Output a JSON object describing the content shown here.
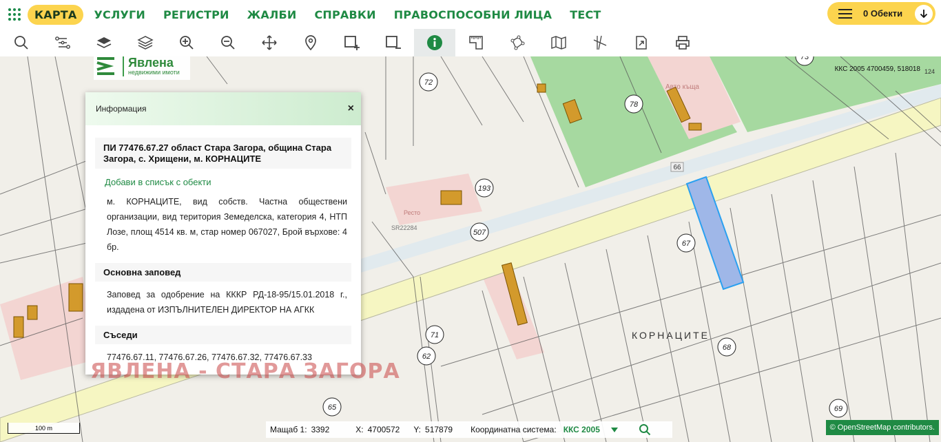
{
  "nav": {
    "items": [
      {
        "label": "КАРТА",
        "active": true
      },
      {
        "label": "УСЛУГИ"
      },
      {
        "label": "РЕГИСТРИ"
      },
      {
        "label": "ЖАЛБИ"
      },
      {
        "label": "СПРАВКИ"
      },
      {
        "label": "ПРАВОСПОСОБНИ ЛИЦА"
      },
      {
        "label": "ТЕСТ"
      }
    ],
    "objects_label": "0 Обекти"
  },
  "toolbar": {
    "tools": [
      "search-icon",
      "route-icon",
      "layers-icon",
      "layers-stack-icon",
      "zoom-in-icon",
      "zoom-out-icon",
      "pan-icon",
      "location-pin-icon",
      "select-add-icon",
      "select-remove-icon",
      "info-icon",
      "measure-icon",
      "polygon-icon",
      "map-icon",
      "crosshair-icon",
      "export-icon",
      "print-icon"
    ],
    "active_tool": "info-icon"
  },
  "logo": {
    "brand": "Явлена",
    "tagline": "недвижими имоти"
  },
  "map": {
    "coords_top": "ККС 2005 4700459, 518018",
    "corner_number": "124",
    "locality": "КОРНАЦИТЕ",
    "parcel_labels": [
      "72",
      "78",
      "73",
      "66",
      "193",
      "507",
      "67",
      "71",
      "62",
      "68",
      "65",
      "69",
      "Авто къща",
      "Ресто",
      "SR22284"
    ],
    "highlight_color": "#9fb7e8"
  },
  "panel": {
    "title": "Информация",
    "close": "×",
    "header": "ПИ 77476.67.27 област Стара Загора, община Стара Загора, с. Хрищени, м. КОРНАЦИТЕ",
    "add_link": "Добави в списък с обекти",
    "description": "м. КОРНАЦИТЕ, вид собств. Частна обществени организации, вид територия Земеделска, категория 4, НТП Лозе, площ 4514 кв. м, стар номер 067027, Брой върхове: 4 бр.",
    "order_title": "Основна заповед",
    "order_text": "Заповед за одобрение на КККР РД-18-95/15.01.2018 г., издадена от ИЗПЪЛНИТЕЛЕН ДИРЕКТОР НА АГКК",
    "neighbors_title": "Съседи",
    "neighbors": "77476.67.11, 77476.67.26, 77476.67.32, 77476.67.33"
  },
  "watermark": "ЯВЛЕНА - СТАРА ЗАГОРА",
  "status": {
    "scale_label": "Мащаб 1:",
    "scale_value": "3392",
    "x_label": "X:",
    "x_value": "4700572",
    "y_label": "Y:",
    "y_value": "517879",
    "crs_label": "Координатна система:",
    "crs_value": "ККС 2005",
    "scalebar": "100 m",
    "attribution": "© OpenStreetMap contributors."
  },
  "colors": {
    "accent": "#1f8a44",
    "nav_active": "#fcd44e",
    "road": "#f6f6c2",
    "green_area": "#a6d9a0",
    "pink_area": "#f3d5d2"
  }
}
